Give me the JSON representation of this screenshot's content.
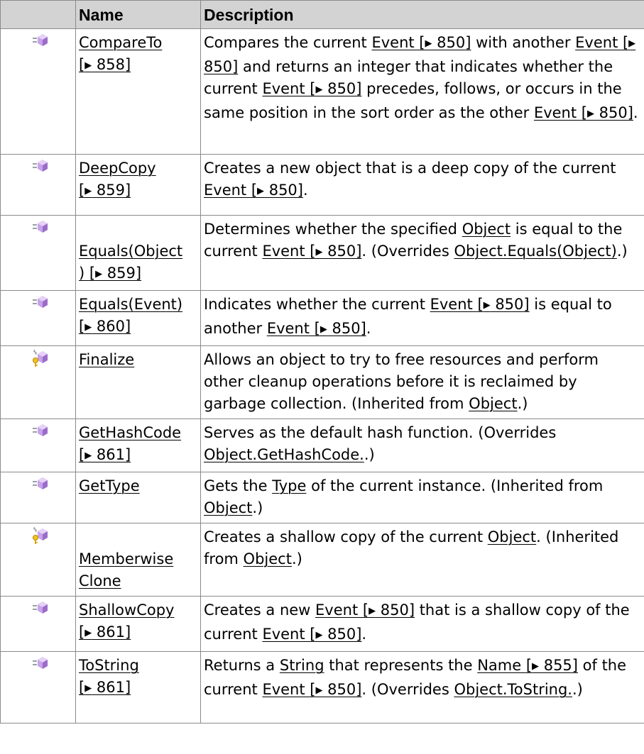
{
  "header": {
    "icon_col": "",
    "name_col": "Name",
    "desc_col": "Description"
  },
  "colors": {
    "header_bg": "#d3d3d3",
    "border": "#8a8a8a",
    "icon_purple": "#b58cd9",
    "icon_yellow": "#f0c419"
  },
  "rows": [
    {
      "icon": "public-method-icon",
      "name": {
        "a": "CompareTo",
        "b": "[",
        "arrow": "▶",
        "c": " 858]"
      },
      "desc": {
        "t1": "Compares the current ",
        "l1": "Event [",
        "l1b": "▶",
        "l1c": " 850]",
        "t2": " with another ",
        "l2": "Event [",
        "l2b": "▶",
        "l2c": " 850]",
        "t3": " and returns an integer that indicates whether the current ",
        "l3": "Event [",
        "l3b": "▶",
        "l3c": " 850]",
        "t4": " precedes, follows, or occurs in the same position in the sort order as the other ",
        "l4": "Event [",
        "l4b": "▶",
        "l4c": " 850]",
        "t5": "."
      }
    },
    {
      "icon": "public-method-icon",
      "name": {
        "a": "DeepCopy",
        "b": "[",
        "arrow": "▶",
        "c": " 859]"
      },
      "desc": {
        "t1": "Creates a new object that is a deep copy of the current ",
        "l1": "Event [",
        "l1b": "▶",
        "l1c": " 850]",
        "t2": "."
      }
    },
    {
      "icon": "public-method-icon",
      "name": {
        "a": "Equals(Object",
        "b": ") [",
        "arrow": "▶",
        "c": " 859]"
      },
      "desc": {
        "t1": "Determines whether the specified ",
        "l1": "Object",
        "t2": " is equal to the current ",
        "l2": "Event [",
        "l2b": "▶",
        "l2c": " 850]",
        "t3": ". (Overrides ",
        "l3": "Object.Equals(Object)",
        "t4": ".)"
      }
    },
    {
      "icon": "public-method-icon",
      "name": {
        "a": "Equals(Event)",
        "b": "[",
        "arrow": "▶",
        "c": " 860]"
      },
      "desc": {
        "t1": "Indicates whether the current ",
        "l1": "Event [",
        "l1b": "▶",
        "l1c": " 850]",
        "t2": " is equal to another ",
        "l2": "Event [",
        "l2b": "▶",
        "l2c": " 850]",
        "t3": "."
      }
    },
    {
      "icon": "protected-method-icon",
      "name": {
        "a": "Finalize"
      },
      "desc": {
        "t1": "Allows an object to try to free resources and perform other cleanup operations before it is reclaimed by garbage collection. (Inherited from ",
        "l1": "Object",
        "t2": ".)"
      }
    },
    {
      "icon": "public-method-icon",
      "name": {
        "a": "GetHashCode",
        "b": "[",
        "arrow": "▶",
        "c": " 861]"
      },
      "desc": {
        "t1": "Serves as the default hash function. (Overrides ",
        "l1": "Object.GetHashCode.",
        "t2": ".)"
      }
    },
    {
      "icon": "public-method-icon",
      "name": {
        "a": "GetType"
      },
      "desc": {
        "t1": "Gets the ",
        "l1": "Type",
        "t2": " of the current instance. (Inherited from ",
        "l2": "Object",
        "t3": ".)"
      }
    },
    {
      "icon": "protected-method-icon",
      "name": {
        "a": "Memberwise",
        "a2": "Clone"
      },
      "desc": {
        "t1": "Creates a shallow copy of the current ",
        "l1": "Object",
        "t2": ". (Inherited from ",
        "l2": "Object",
        "t3": ".)"
      }
    },
    {
      "icon": "public-method-icon",
      "name": {
        "a": "ShallowCopy",
        "b": "[",
        "arrow": "▶",
        "c": " 861]"
      },
      "desc": {
        "t1": "Creates a new ",
        "l1": "Event [",
        "l1b": "▶",
        "l1c": " 850]",
        "t2": " that is a shallow copy of the current ",
        "l2": "Event [",
        "l2b": "▶",
        "l2c": " 850]",
        "t3": "."
      }
    },
    {
      "icon": "public-method-icon",
      "name": {
        "a": "ToString",
        "b": "[",
        "arrow": "▶",
        "c": " 861]"
      },
      "desc": {
        "t1": "Returns a ",
        "l1": "String",
        "t2": " that represents the ",
        "l2": "Name [",
        "l2b": "▶",
        "l2c": " 855]",
        "t3": " of the current ",
        "l3": "Event [",
        "l3b": "▶",
        "l3c": " 850]",
        "t4": ". (Overrides ",
        "l4": "Object.ToString.",
        "t5": ".)"
      }
    }
  ]
}
